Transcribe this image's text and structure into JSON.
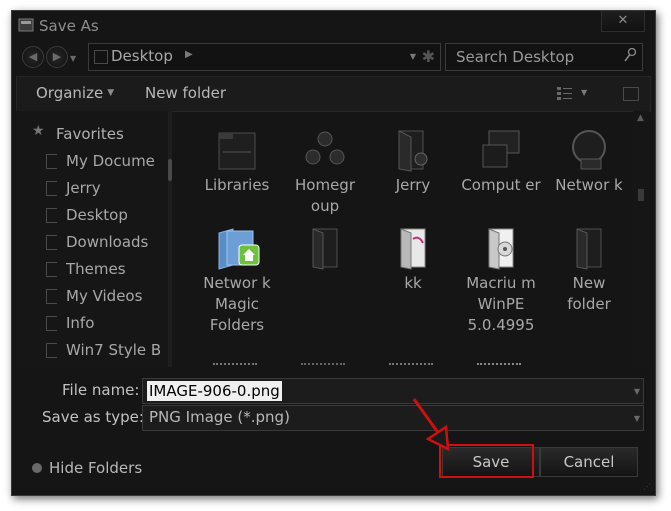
{
  "window": {
    "title": "Save As",
    "close_label": "✕"
  },
  "nav": {
    "back_icon": "back-arrow-icon",
    "forward_icon": "forward-arrow-icon",
    "address_text": "Desktop",
    "search_placeholder": "Search Desktop"
  },
  "toolbar": {
    "organize_label": "Organize",
    "new_folder_label": "New folder"
  },
  "sidebar": {
    "favorites_label": "Favorites",
    "items": [
      {
        "label": "My Docume"
      },
      {
        "label": "Jerry"
      },
      {
        "label": "Desktop"
      },
      {
        "label": "Downloads"
      },
      {
        "label": "Themes"
      },
      {
        "label": "My Videos"
      },
      {
        "label": "Info"
      },
      {
        "label": "Win7 Style B"
      }
    ]
  },
  "files": [
    {
      "label": "Libraries",
      "icon": "libraries-icon"
    },
    {
      "label": "Homegr oup",
      "icon": "homegroup-icon"
    },
    {
      "label": "Jerry",
      "icon": "user-folder-icon"
    },
    {
      "label": "Comput er",
      "icon": "computer-icon"
    },
    {
      "label": "Networ k",
      "icon": "network-icon"
    },
    {
      "label": "Networ k Magic Folders",
      "icon": "blue-folder-icon"
    },
    {
      "label": "",
      "icon": "folder-icon"
    },
    {
      "label": "kk",
      "icon": "kk-folder-icon"
    },
    {
      "label": "Macriu m WinPE 5.0.4995",
      "icon": "cd-folder-icon"
    },
    {
      "label": "New folder",
      "icon": "folder-icon"
    }
  ],
  "form": {
    "file_name_label": "File name:",
    "file_name_value": "IMAGE-906-0.png",
    "save_as_type_label": "Save as type:",
    "save_as_type_value": "PNG Image (*.png)"
  },
  "footer": {
    "hide_folders_label": "Hide Folders",
    "save_label": "Save",
    "cancel_label": "Cancel"
  },
  "colors": {
    "background": "#151515",
    "text": "#b8b8b8",
    "highlight_red": "#cc1111"
  }
}
